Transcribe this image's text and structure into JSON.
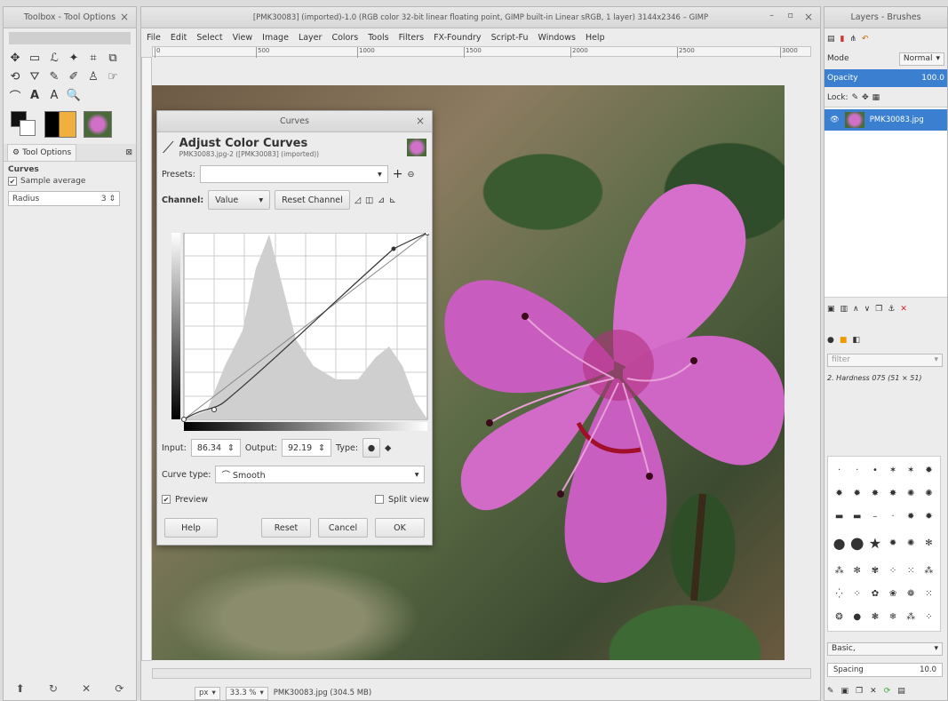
{
  "toolbox": {
    "title": "Toolbox - Tool Options",
    "tab_label": "Tool Options",
    "tool_name": "Curves",
    "sample_average_label": "Sample average",
    "radius_label": "Radius",
    "radius_value": "3"
  },
  "image_window": {
    "title": "[PMK30083] (imported)-1.0 (RGB color 32-bit linear floating point, GIMP built-in Linear sRGB, 1 layer) 3144x2346 – GIMP",
    "menu": [
      "File",
      "Edit",
      "Select",
      "View",
      "Image",
      "Layer",
      "Colors",
      "Tools",
      "Filters",
      "FX-Foundry",
      "Script-Fu",
      "Windows",
      "Help"
    ],
    "ruler_ticks": [
      "0",
      "500",
      "1000",
      "1500",
      "2000",
      "2500",
      "3000"
    ],
    "status": {
      "unit": "px",
      "zoom": "33.3 %",
      "file_info": "PMK30083.jpg (304.5 MB)"
    }
  },
  "curves_dialog": {
    "window_title": "Curves",
    "heading": "Adjust Color Curves",
    "subheading": "PMK30083.jpg-2 ([PMK30083] (imported))",
    "presets_label": "Presets:",
    "channel_label": "Channel:",
    "channel_value": "Value",
    "reset_channel_label": "Reset Channel",
    "input_label": "Input:",
    "input_value": "86.34",
    "output_label": "Output:",
    "output_value": "92.19",
    "type_label": "Type:",
    "curve_type_label": "Curve type:",
    "curve_type_value": "Smooth",
    "preview_label": "Preview",
    "split_view_label": "Split view",
    "buttons": {
      "help": "Help",
      "reset": "Reset",
      "cancel": "Cancel",
      "ok": "OK"
    }
  },
  "layers_panel": {
    "title": "Layers - Brushes",
    "mode_label": "Mode",
    "mode_value": "Normal",
    "opacity_label": "Opacity",
    "opacity_value": "100.0",
    "lock_label": "Lock:",
    "layer_name": "PMK30083.jpg",
    "filter_placeholder": "filter",
    "brush_name": "2. Hardness 075 (51 × 51)",
    "brush_tag": "Basic,",
    "spacing_label": "Spacing",
    "spacing_value": "10.0"
  },
  "colors": {
    "accent": "#3a7fd0",
    "flower": "#d070c8"
  }
}
